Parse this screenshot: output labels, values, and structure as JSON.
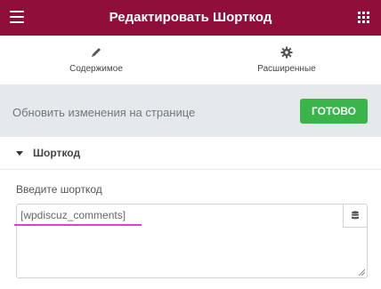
{
  "header": {
    "title": "Редактировать Шорткод",
    "menu_icon": "hamburger-icon",
    "apps_icon": "grid-icon"
  },
  "tabs": [
    {
      "label": "Содержимое",
      "icon": "pencil-icon",
      "active": true
    },
    {
      "label": "Расширенные",
      "icon": "gear-icon",
      "active": false
    }
  ],
  "update_bar": {
    "text": "Обновить изменения на странице",
    "done_label": "ГОТОВО"
  },
  "section": {
    "title": "Шорткод",
    "field_label": "Введите шорткод",
    "shortcode_value": "[wpdiscuz_comments]",
    "dynamic_icon": "database-icon"
  },
  "colors": {
    "brand": "#8f0e3a",
    "success": "#39b54a",
    "highlight": "#e639e0"
  }
}
